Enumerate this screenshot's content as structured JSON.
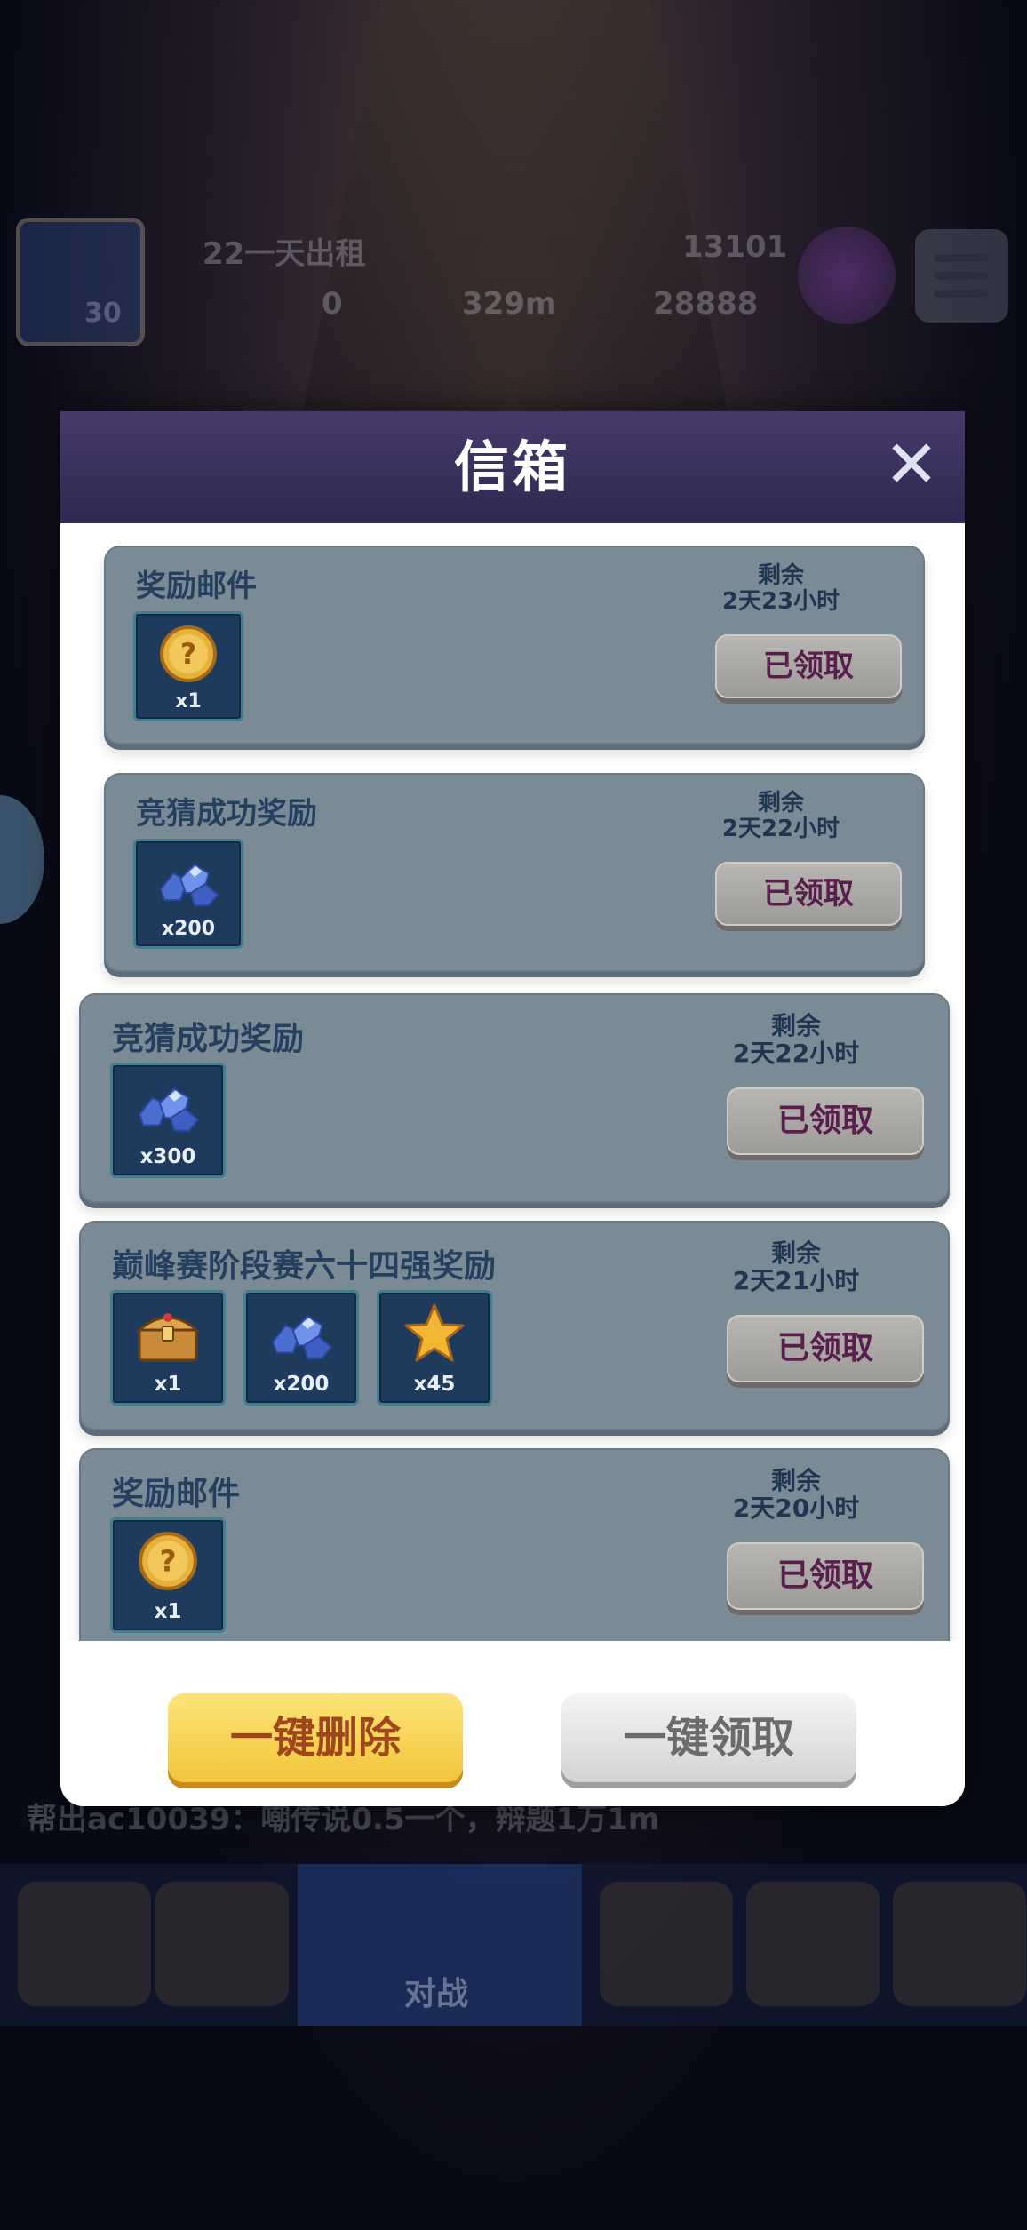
{
  "background": {
    "player_location": "22一天出租",
    "trophies": "13101",
    "coins": "0",
    "distance": "329m",
    "gems": "28888",
    "level": "30",
    "ticker": "帮出ac10039：嘲传说0.5一个，辩题1万1m",
    "nav_active_label": "对战"
  },
  "dialog": {
    "title": "信箱",
    "close_icon": "close-icon",
    "mails": [
      {
        "title": "奖励邮件",
        "remain_label": "剩余",
        "remain_time": "2天23小时",
        "status": "已领取",
        "items": [
          {
            "icon": "mystery-coin-icon",
            "count": "x1"
          }
        ]
      },
      {
        "title": "竞猜成功奖励",
        "remain_label": "剩余",
        "remain_time": "2天22小时",
        "status": "已领取",
        "items": [
          {
            "icon": "gem-pile-icon",
            "count": "x200"
          }
        ]
      },
      {
        "title": "竞猜成功奖励",
        "remain_label": "剩余",
        "remain_time": "2天22小时",
        "status": "已领取",
        "items": [
          {
            "icon": "gem-pile-icon",
            "count": "x300"
          }
        ]
      },
      {
        "title": "巅峰赛阶段赛六十四强奖励",
        "remain_label": "剩余",
        "remain_time": "2天21小时",
        "status": "已领取",
        "items": [
          {
            "icon": "treasure-chest-icon",
            "count": "x1"
          },
          {
            "icon": "gem-pile-icon",
            "count": "x200"
          },
          {
            "icon": "star-icon",
            "count": "x45"
          }
        ]
      },
      {
        "title": "奖励邮件",
        "remain_label": "剩余",
        "remain_time": "2天20小时",
        "status": "已领取",
        "items": [
          {
            "icon": "mystery-coin-icon",
            "count": "x1"
          }
        ]
      }
    ],
    "footer": {
      "delete_all": "一键删除",
      "claim_all": "一键领取"
    }
  }
}
